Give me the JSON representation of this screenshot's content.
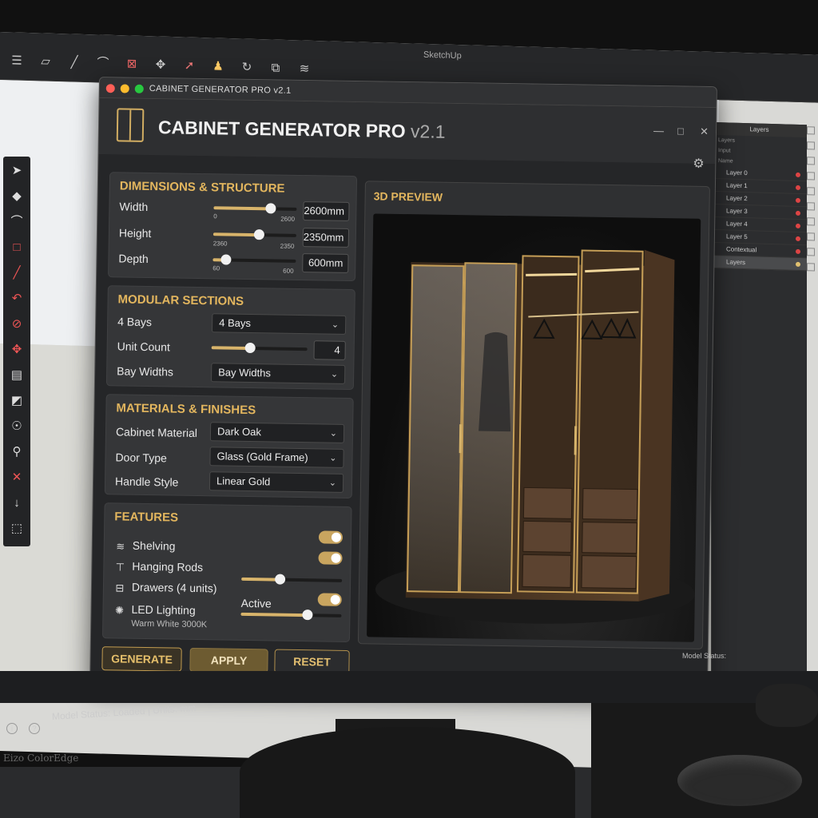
{
  "sketchup": {
    "title": "SketchUp",
    "status_text": "Model Status: Loaded | Units: mm",
    "status_right": "Model Status:",
    "brand": "Eizo ColorEdge",
    "toolbar_icons": [
      "menu-icon",
      "eraser-icon",
      "line-icon",
      "arc-icon",
      "rectangle-icon",
      "move-icon",
      "paint-icon",
      "push-pull-icon",
      "rotate-icon",
      "scale-icon",
      "layers-icon"
    ]
  },
  "layers_panel": {
    "title": "Layers",
    "subtitle": "Layers",
    "filter": "Input",
    "header": "Name",
    "layers": [
      "Layer 0",
      "Layer 1",
      "Layer 2",
      "Layer 3",
      "Layer 4",
      "Layer 5",
      "Contextual",
      "Layers"
    ]
  },
  "plugin": {
    "window_title": "CABINET GENERATOR PRO v2.1",
    "app_title": "CABINET GENERATOR PRO",
    "app_version": "v2.1",
    "dimensions": {
      "title": "DIMENSIONS & STRUCTURE",
      "width": {
        "label": "Width",
        "min": "0",
        "max": "2600",
        "value": "2600mm",
        "level": 0.68
      },
      "height": {
        "label": "Height",
        "min": "2360",
        "max": "2350",
        "value": "2350mm",
        "level": 0.55
      },
      "depth": {
        "label": "Depth",
        "min": "60",
        "max": "600",
        "value": "600mm",
        "level": 0.15
      }
    },
    "modular": {
      "title": "MODULAR SECTIONS",
      "bays_label": "4 Bays",
      "bays_value": "4 Bays",
      "unit_label": "Unit Count",
      "unit_value": "4",
      "unit_level": 0.4,
      "bay_widths_label": "Bay Widths",
      "bay_widths_value": "Bay Widths"
    },
    "materials": {
      "title": "MATERIALS & FINISHES",
      "cabinet_label": "Cabinet Material",
      "cabinet_value": "Dark Oak",
      "door_label": "Door Type",
      "door_value": "Glass (Gold Frame)",
      "handle_label": "Handle Style",
      "handle_value": "Linear Gold"
    },
    "features": {
      "title": "FEATURES",
      "shelving": "Shelving",
      "hanging_rods": "Hanging Rods",
      "drawers": "Drawers (4 units)",
      "drawers_level": 0.38,
      "led": "LED Lighting",
      "led_sub": "Warm White 3000K",
      "active": "Active",
      "led_level": 0.66
    },
    "preview_title": "3D PREVIEW",
    "buttons": {
      "generate": "GENERATE",
      "apply": "APPLY",
      "reset": "RESET"
    }
  },
  "colors": {
    "accent": "#e3b65e",
    "gold": "#d1ad62",
    "panel": "#353638"
  }
}
